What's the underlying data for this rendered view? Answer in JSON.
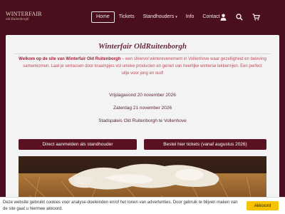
{
  "logo": {
    "main": "WINTERFAIR",
    "sub": "old Ruitenborgh"
  },
  "nav": {
    "items": [
      {
        "label": "Home"
      },
      {
        "label": "Tickets"
      },
      {
        "label": "Standhouders"
      },
      {
        "label": "Info"
      },
      {
        "label": "Contact"
      }
    ],
    "dropdown_caret": "▾",
    "icons": [
      "user-icon",
      "search-icon",
      "cart-icon"
    ]
  },
  "main": {
    "title": "Winterfair OldRuitenborgh",
    "intro_bold": "Welkom op de site van Winterfair Old Ruitenborgh",
    "intro_rest": " – een sfeervol wintereve­nement in Vollenhove waar gezelligheid en beleving samenkomen. Laat je verrassen door kraampjes vol unieke producten en geniet van heerlijke winterse lekkernijen. Een perfect uitje voor jong en oud!",
    "event_day1": "Vrijdagavond 20 november 2026",
    "event_day2": "Zaterdag 21 november 2026",
    "location": "Stadspaleis Old Ruitenborgh te Vollenhove",
    "btn_standhouder": "Direct aanmelden als standhouder",
    "btn_tickets": "Bestel hier tickets (vanaf augustus 2026)"
  },
  "cookie": {
    "text": "Deze website gebruikt cookies voor analyse-doeleinden en/of het tonen van advertenties. Door gebruik te blijven maken van de site gaat u hiermee akkoord.",
    "button": "Akkoord"
  },
  "colors": {
    "brand": "#4a0f1e",
    "button": "#5a1122",
    "accent_yellow": "#f7c300"
  }
}
